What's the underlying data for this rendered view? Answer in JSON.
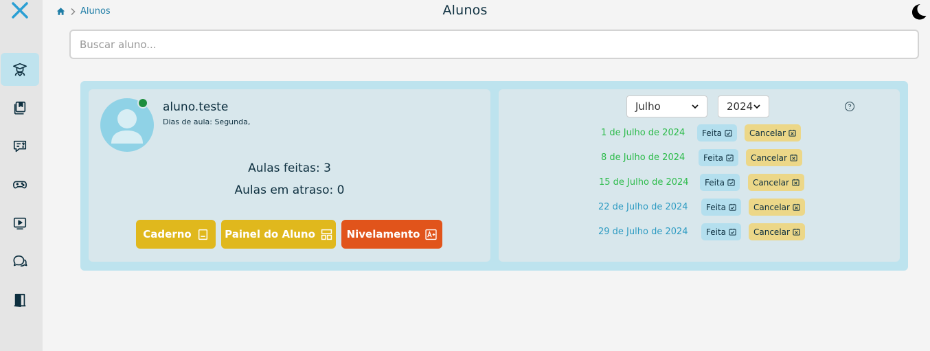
{
  "sidebar": {
    "close_icon": "close-icon",
    "items": [
      {
        "name": "students",
        "icon": "teacher-icon",
        "active": true
      },
      {
        "name": "notebooks",
        "icon": "book-icon"
      },
      {
        "name": "questions",
        "icon": "chat-question-icon"
      },
      {
        "name": "games",
        "icon": "gamepad-icon"
      },
      {
        "name": "videos",
        "icon": "play-icon"
      },
      {
        "name": "chat",
        "icon": "chat-bubbles-icon"
      },
      {
        "name": "logout",
        "icon": "door-icon"
      }
    ]
  },
  "header": {
    "breadcrumb": {
      "home_icon": "home-icon",
      "current": "Alunos"
    },
    "title": "Alunos",
    "theme_icon": "moon-icon"
  },
  "search": {
    "placeholder": "Buscar aluno..."
  },
  "student": {
    "name": "aluno.teste",
    "days": "Dias de aula: Segunda,",
    "status": "online",
    "lessons_done": "Aulas feitas: 3",
    "lessons_late": "Aulas em atraso: 0",
    "buttons": {
      "notebook": "Caderno",
      "panel": "Painel do Aluno",
      "leveling": "Nivelamento"
    }
  },
  "schedule": {
    "month": "Julho",
    "year": "2024",
    "help_icon": "help-circle-icon",
    "done_label": "Feita",
    "cancel_label": "Cancelar",
    "lessons": [
      {
        "date": "1 de Julho de 2024",
        "status": "past"
      },
      {
        "date": "8 de Julho de 2024",
        "status": "past"
      },
      {
        "date": "15 de Julho de 2024",
        "status": "past"
      },
      {
        "date": "22 de Julho de 2024",
        "status": "upcoming"
      },
      {
        "date": "29 de Julho de 2024",
        "status": "upcoming"
      }
    ]
  },
  "colors": {
    "accent_blue": "#1f7da6",
    "card_bg": "#bde3ee",
    "panel_bg": "#d8e7ec",
    "button_yellow": "#e0b81d",
    "button_orange": "#e1541b",
    "date_green": "#2cbb4a",
    "date_blue": "#2d9bc2",
    "online_green": "#1e8e3e"
  }
}
